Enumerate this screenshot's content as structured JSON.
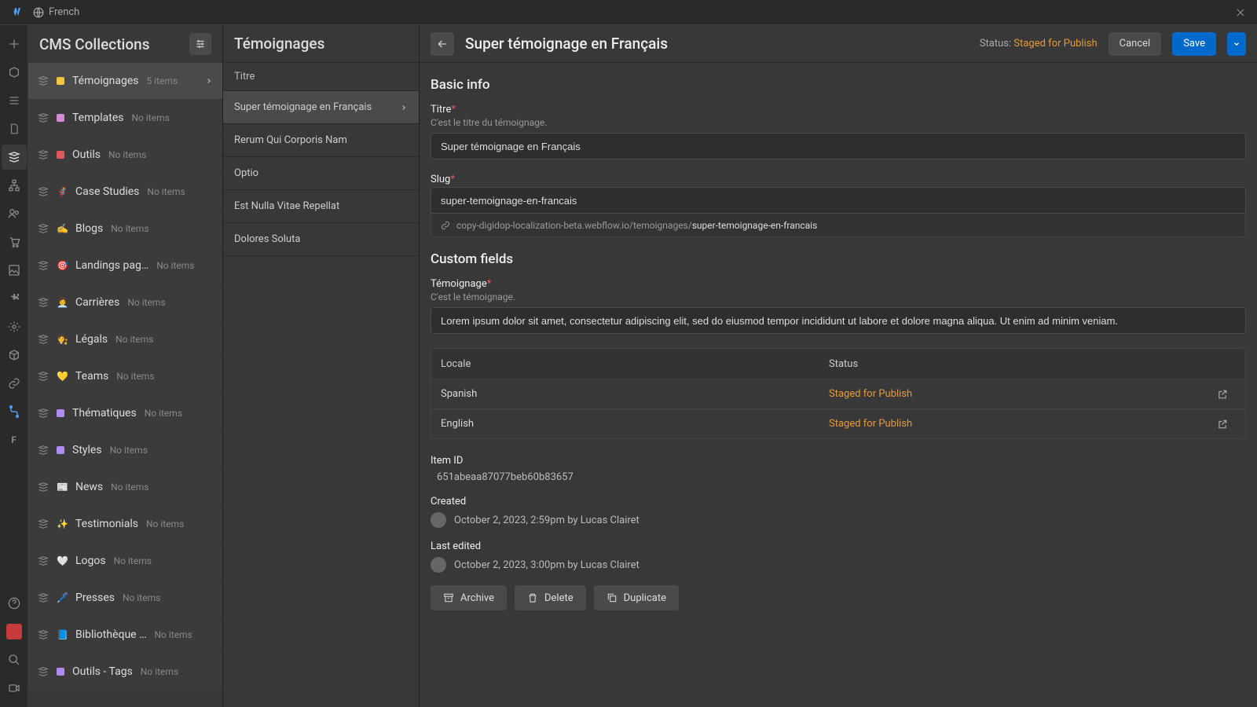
{
  "topbar": {
    "language": "French"
  },
  "collections_panel": {
    "title": "CMS Collections",
    "items": [
      {
        "name": "Témoignages",
        "count": "5 items",
        "dot": "#f5c242",
        "active": true
      },
      {
        "name": "Templates",
        "count": "No items",
        "dot": "#d48ad4"
      },
      {
        "name": "Outils",
        "count": "No items",
        "dot": "#e05a5a"
      },
      {
        "name": "Case Studies",
        "count": "No items",
        "emoji": "🦸"
      },
      {
        "name": "Blogs",
        "count": "No items",
        "emoji": "✍️"
      },
      {
        "name": "Landings pag…",
        "count": "No items",
        "emoji": "🎯"
      },
      {
        "name": "Carrières",
        "count": "No items",
        "emoji": "👩‍💼"
      },
      {
        "name": "Légals",
        "count": "No items",
        "emoji": "🧑‍⚖️"
      },
      {
        "name": "Teams",
        "count": "No items",
        "emoji": "💛"
      },
      {
        "name": "Thématiques",
        "count": "No items",
        "dot": "#b08af5"
      },
      {
        "name": "Styles",
        "count": "No items",
        "dot": "#b08af5"
      },
      {
        "name": "News",
        "count": "No items",
        "emoji": "📰"
      },
      {
        "name": "Testimonials",
        "count": "No items",
        "emoji": "✨"
      },
      {
        "name": "Logos",
        "count": "No items",
        "emoji": "🤍"
      },
      {
        "name": "Presses",
        "count": "No items",
        "emoji": "🖊️"
      },
      {
        "name": "Bibliothèque …",
        "count": "No items",
        "emoji": "📘"
      },
      {
        "name": "Outils - Tags",
        "count": "No items",
        "dot": "#b08af5"
      }
    ]
  },
  "items_panel": {
    "title": "Témoignages",
    "field_header": "Titre",
    "items": [
      {
        "title": "Super témoignage en Français",
        "active": true
      },
      {
        "title": "Rerum Qui Corporis Nam"
      },
      {
        "title": "Optio"
      },
      {
        "title": "Est Nulla Vitae Repellat"
      },
      {
        "title": "Dolores Soluta"
      }
    ]
  },
  "editor": {
    "title": "Super témoignage en Français",
    "status_label": "Status:",
    "status_value": "Staged for Publish",
    "cancel": "Cancel",
    "save": "Save",
    "basic_info": {
      "section": "Basic info",
      "titre_label": "Titre",
      "titre_desc": "C'est le titre du témoignage.",
      "titre_value": "Super témoignage en Français",
      "slug_label": "Slug",
      "slug_value": "super-temoignage-en-francais",
      "slug_base": "copy-digidop-localization-beta.webflow.io/temoignages/",
      "slug_suffix": "super-temoignage-en-francais"
    },
    "custom": {
      "section": "Custom fields",
      "temoignage_label": "Témoignage",
      "temoignage_desc": "C'est le témoignage.",
      "temoignage_value": "Lorem ipsum dolor sit amet, consectetur adipiscing elit, sed do eiusmod tempor incididunt ut labore et dolore magna aliqua. Ut enim ad minim veniam."
    },
    "locales": {
      "header_locale": "Locale",
      "header_status": "Status",
      "rows": [
        {
          "locale": "Spanish",
          "status": "Staged for Publish"
        },
        {
          "locale": "English",
          "status": "Staged for Publish"
        }
      ]
    },
    "meta": {
      "item_id_label": "Item ID",
      "item_id_value": "651abeaa87077beb60b83657",
      "created_label": "Created",
      "created_value": "October 2, 2023, 2:59pm by Lucas Clairet",
      "edited_label": "Last edited",
      "edited_value": "October 2, 2023, 3:00pm by Lucas Clairet"
    },
    "actions": {
      "archive": "Archive",
      "delete": "Delete",
      "duplicate": "Duplicate"
    }
  }
}
